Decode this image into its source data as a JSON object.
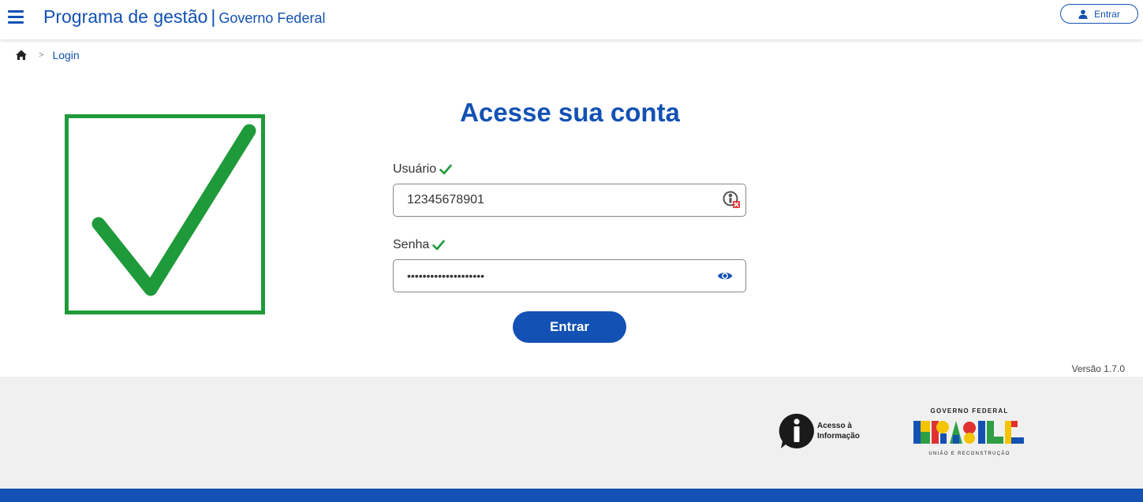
{
  "header": {
    "title": "Programa de gestão",
    "separator": "|",
    "subtitle": "Governo Federal",
    "signin_label": "Entrar"
  },
  "breadcrumb": {
    "separator": ">",
    "current": "Login"
  },
  "login": {
    "title": "Acesse sua conta",
    "username_label": "Usuário",
    "username_value": "12345678901",
    "password_label": "Senha",
    "password_value": "••••••••••••••••••••",
    "submit_label": "Entrar"
  },
  "version": "Versão 1.7.0",
  "footer": {
    "access_info_line1": "Acesso à",
    "access_info_line2": "Informação",
    "gov_logo_top": "GOVERNO FEDERAL",
    "gov_logo_word": "BRASIL",
    "gov_logo_bottom": "UNIÃO E RECONSTRUÇÃO"
  },
  "icons": {
    "menu": "hamburger-icon",
    "user": "user-icon",
    "home": "home-icon",
    "validation": "check-icon",
    "password_toggle": "eye-icon",
    "autofill": "password-manager-icon"
  },
  "colors": {
    "primary": "#1351b4",
    "success": "#1f9a3a",
    "footer_bg": "#f0f0f0"
  }
}
